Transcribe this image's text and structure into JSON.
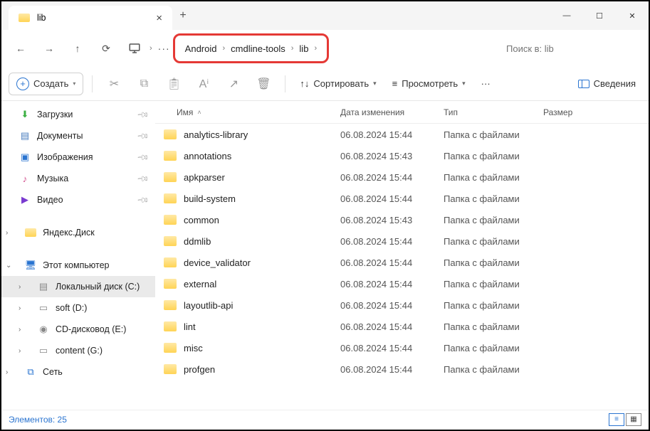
{
  "tab": {
    "title": "lib"
  },
  "window": {
    "min": "—",
    "max": "☐",
    "close": "✕"
  },
  "breadcrumb": {
    "seg1": "Android",
    "seg2": "cmdline-tools",
    "seg3": "lib"
  },
  "search": {
    "placeholder": "Поиск в: lib"
  },
  "toolbar": {
    "create": "Создать",
    "sort": "Сортировать",
    "view": "Просмотреть",
    "more": "···",
    "details": "Сведения"
  },
  "sidebar": {
    "downloads": "Загрузки",
    "documents": "Документы",
    "pictures": "Изображения",
    "music": "Музыка",
    "videos": "Видео",
    "yandex": "Яндекс.Диск",
    "thispc": "Этот компьютер",
    "localc": "Локальный диск (C:)",
    "softd": "soft (D:)",
    "cde": "CD-дисковод (E:)",
    "contentg": "content (G:)",
    "network": "Сеть"
  },
  "columns": {
    "name": "Имя",
    "date": "Дата изменения",
    "type": "Тип",
    "size": "Размер"
  },
  "type_folder": "Папка с файлами",
  "files": [
    {
      "name": "analytics-library",
      "date": "06.08.2024 15:44"
    },
    {
      "name": "annotations",
      "date": "06.08.2024 15:43"
    },
    {
      "name": "apkparser",
      "date": "06.08.2024 15:44"
    },
    {
      "name": "build-system",
      "date": "06.08.2024 15:44"
    },
    {
      "name": "common",
      "date": "06.08.2024 15:43"
    },
    {
      "name": "ddmlib",
      "date": "06.08.2024 15:44"
    },
    {
      "name": "device_validator",
      "date": "06.08.2024 15:44"
    },
    {
      "name": "external",
      "date": "06.08.2024 15:44"
    },
    {
      "name": "layoutlib-api",
      "date": "06.08.2024 15:44"
    },
    {
      "name": "lint",
      "date": "06.08.2024 15:44"
    },
    {
      "name": "misc",
      "date": "06.08.2024 15:44"
    },
    {
      "name": "profgen",
      "date": "06.08.2024 15:44"
    }
  ],
  "status": {
    "count_label": "Элементов: 25"
  }
}
